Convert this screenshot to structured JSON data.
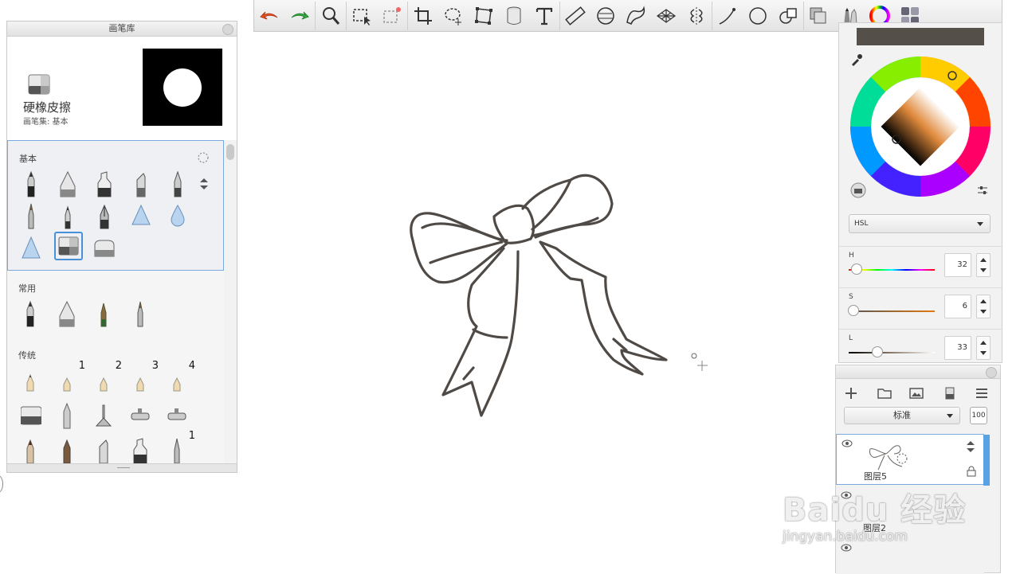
{
  "brush_library": {
    "title": "画笔库",
    "selected_brush": {
      "name": "硬橡皮擦",
      "set": "画笔集: 基本"
    },
    "sections": [
      {
        "title": "基本"
      },
      {
        "title": "常用"
      },
      {
        "title": "传统",
        "badges": [
          "1",
          "2",
          "3",
          "4",
          "1"
        ]
      }
    ]
  },
  "color_editor": {
    "current_color": "#554f4a",
    "model": "HSL",
    "h": {
      "label": "H",
      "value": "32",
      "fraction": 0.09
    },
    "s": {
      "label": "S",
      "value": "6",
      "fraction": 0.06
    },
    "l": {
      "label": "L",
      "value": "33",
      "fraction": 0.33
    }
  },
  "layers": {
    "blend_mode": "标准",
    "opacity": "100",
    "items": [
      {
        "name": "图层5",
        "visible": true,
        "active": true
      },
      {
        "name": "图层2",
        "visible": true,
        "active": false
      },
      {
        "name": "",
        "visible": true,
        "active": false
      }
    ]
  },
  "watermark": {
    "brand": "Baidu 经验",
    "url": "jingyan.baidu.com"
  },
  "toolbar": {
    "tools": [
      "undo-icon",
      "redo-icon",
      "zoom-icon",
      "select-icon",
      "select-add-icon",
      "crop-icon",
      "lasso-icon",
      "transform-icon",
      "fill-icon",
      "text-icon",
      "ruler-icon",
      "ellipse-guide-icon",
      "french-curve-icon",
      "perspective-icon",
      "symmetry-icon",
      "stroke-icon",
      "shape-icon",
      "copy-icon",
      "layers-icon",
      "brushes-icon",
      "color-wheel-icon",
      "grid-icon"
    ]
  }
}
